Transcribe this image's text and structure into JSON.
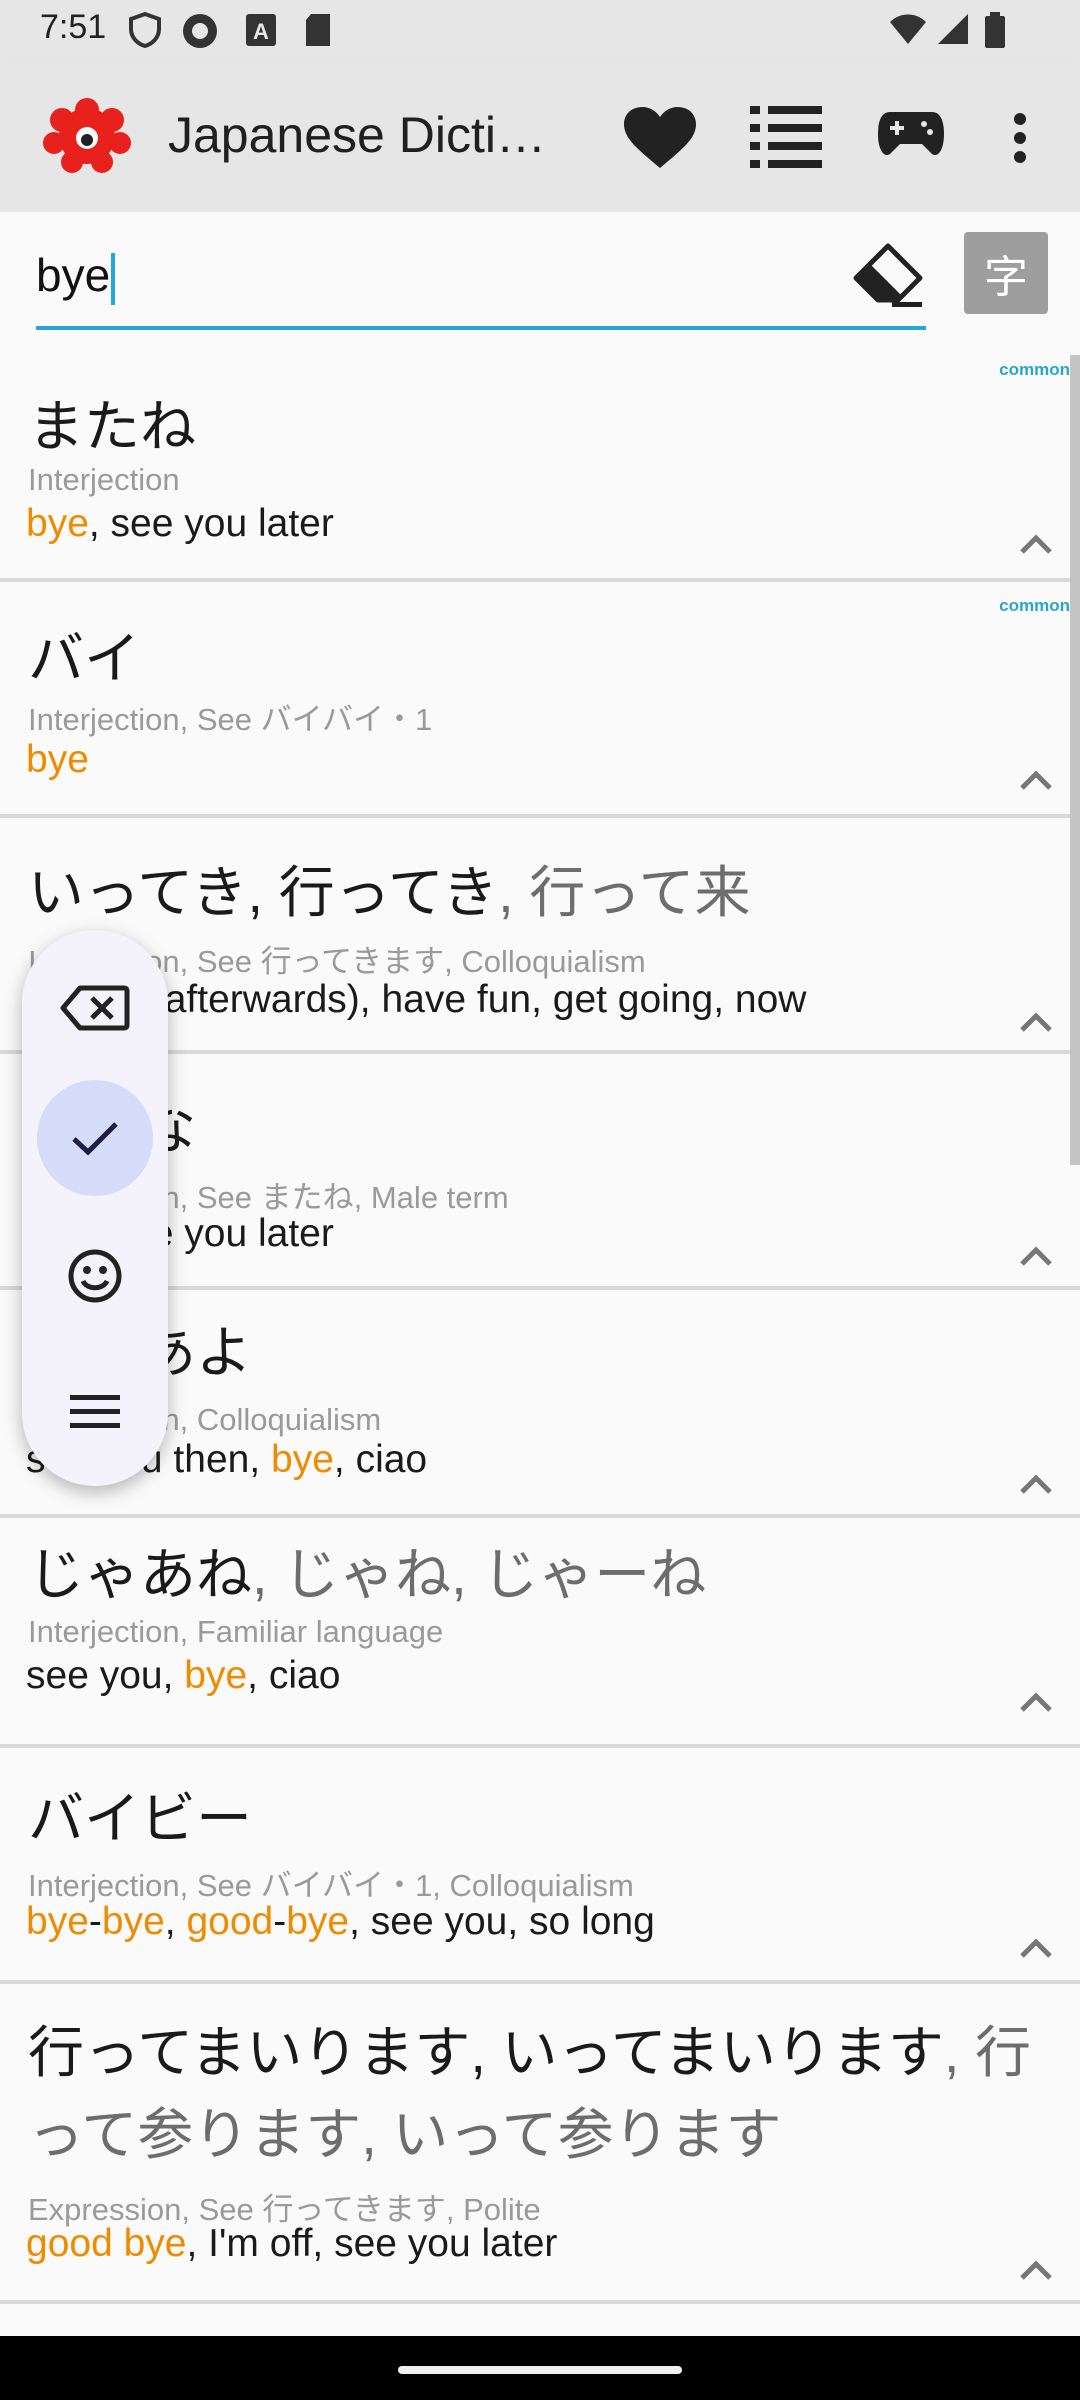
{
  "status_bar": {
    "time": "7:51"
  },
  "app_bar": {
    "title": "Japanese Dicti…"
  },
  "search": {
    "value": "bye",
    "kanji_button": "字"
  },
  "results": [
    {
      "common": "common",
      "word": "またね",
      "word_alt": "",
      "pos": "Interjection",
      "gloss": [
        {
          "t": "bye",
          "hl": true
        },
        {
          "t": ", see you later",
          "hl": false
        }
      ]
    },
    {
      "common": "common",
      "word": "バイ",
      "word_alt": "",
      "pos": "Interjection, See バイバイ・1",
      "gloss": [
        {
          "t": "bye",
          "hl": true
        }
      ]
    },
    {
      "common": "",
      "word": "いってき, 行ってき",
      "word_alt": ", 行って来",
      "pos": "Interjection, See 行ってきます, Colloquialism",
      "gloss": [
        {
          "t": "see ya (afterwards), have fun, get going, now",
          "hl": false
        }
      ]
    },
    {
      "common": "",
      "word": "じゃな",
      "word_alt": "",
      "pos": "Interjection, See またね, Male term",
      "gloss": [
        {
          "t": "bye, see you later",
          "hl": false
        }
      ]
    },
    {
      "common": "",
      "word": "じゃあよ",
      "word_alt": "",
      "pos": "Interjection, Colloquialism",
      "gloss": [
        {
          "t": "see you then, ",
          "hl": false
        },
        {
          "t": "bye",
          "hl": true
        },
        {
          "t": ", ciao",
          "hl": false
        }
      ]
    },
    {
      "common": "",
      "word": "じゃあね",
      "word_alt": ", じゃね, じゃーね",
      "pos": "Interjection, Familiar language",
      "gloss": [
        {
          "t": "see you, ",
          "hl": false
        },
        {
          "t": "bye",
          "hl": true
        },
        {
          "t": ", ciao",
          "hl": false
        }
      ]
    },
    {
      "common": "",
      "word": "バイビー",
      "word_alt": "",
      "pos": "Interjection, See バイバイ・1, Colloquialism",
      "gloss": [
        {
          "t": "bye",
          "hl": true
        },
        {
          "t": "-",
          "hl": false
        },
        {
          "t": "bye",
          "hl": true
        },
        {
          "t": ", ",
          "hl": false
        },
        {
          "t": "good",
          "hl": true
        },
        {
          "t": "-",
          "hl": false
        },
        {
          "t": "bye",
          "hl": true
        },
        {
          "t": ", see you, so long",
          "hl": false
        }
      ]
    },
    {
      "common": "",
      "word": "行ってまいります, いってまいります",
      "word_alt": ", 行って参ります, いって参ります",
      "pos": "Expression, See 行ってきます, Polite",
      "gloss": [
        {
          "t": "good bye",
          "hl": true
        },
        {
          "t": ", I'm off, see you later",
          "hl": false
        }
      ]
    }
  ],
  "colors": {
    "accent": "#27a5dd",
    "highlight": "#ef8b00",
    "app_bar": "#e6e6e6",
    "logo": "#e8211d"
  }
}
